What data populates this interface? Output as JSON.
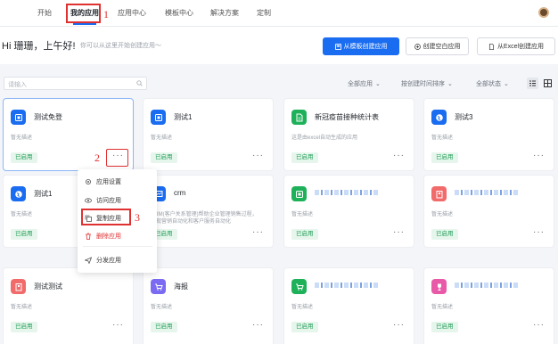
{
  "nav": {
    "tabs": [
      "开始",
      "我的应用",
      "应用中心",
      "模板中心",
      "解决方案",
      "定制"
    ]
  },
  "greeting": {
    "title": "Hi 珊珊，上午好!",
    "subtitle": "你可以从这里开始创建应用～"
  },
  "actions": {
    "from_template": "从模板创建应用",
    "blank": "创建空白应用",
    "from_excel": "从Excel创建应用"
  },
  "search": {
    "placeholder": "请输入"
  },
  "filters": {
    "all_apps": "全部应用",
    "sort": "按创建时间排序",
    "status": "全部状态"
  },
  "annotations": [
    "1",
    "2",
    "3"
  ],
  "cards": [
    {
      "name": "测试免登",
      "desc": "暂无描述",
      "status": "已启用",
      "icon": "app-icon",
      "color": "#1a6cf0"
    },
    {
      "name": "测试1",
      "desc": "暂无描述",
      "status": "已启用",
      "icon": "app-icon",
      "color": "#1a6cf0"
    },
    {
      "name": "新冠疫苗接种统计表",
      "desc": "这是由excel自动生成的应用",
      "status": "已启用",
      "icon": "document-icon",
      "color": "#1fb15a"
    },
    {
      "name": "测试3",
      "desc": "暂无描述",
      "status": "已启用",
      "icon": "globe-icon",
      "color": "#1a6cf0"
    },
    {
      "name": "测试1",
      "desc": "暂无描述",
      "status": "已启用",
      "icon": "globe-icon",
      "color": "#1a6cf0"
    },
    {
      "name": "crm",
      "desc": "CRM(客户关系管理)帮助企业管理销售过程，",
      "desc2": "实现营销自动化和客户服务自动化",
      "status": "已启用",
      "icon": "chart-icon",
      "color": "#1a6cf0"
    },
    {
      "name": "",
      "desc": "暂无描述",
      "status": "已启用",
      "icon": "app-icon",
      "color": "#1fb15a"
    },
    {
      "name": "",
      "desc": "暂无描述",
      "status": "已启用",
      "icon": "building-icon",
      "color": "#f26b6b"
    },
    {
      "name": "测试测试",
      "desc": "暂无描述",
      "status": "已启用",
      "icon": "building-icon",
      "color": "#f26b6b"
    },
    {
      "name": "海报",
      "desc": "暂无描述",
      "status": "已启用",
      "icon": "cart-icon",
      "color": "#7a6bf2"
    },
    {
      "name": "",
      "desc": "暂无描述",
      "status": "已启用",
      "icon": "cart-icon",
      "color": "#1fb15a"
    },
    {
      "name": "",
      "desc": "暂无描述",
      "status": "已启用",
      "icon": "trophy-icon",
      "color": "#e85aa8"
    }
  ],
  "menu": {
    "items": [
      "应用设置",
      "访问应用",
      "复制应用",
      "删除应用",
      "分发应用"
    ]
  }
}
